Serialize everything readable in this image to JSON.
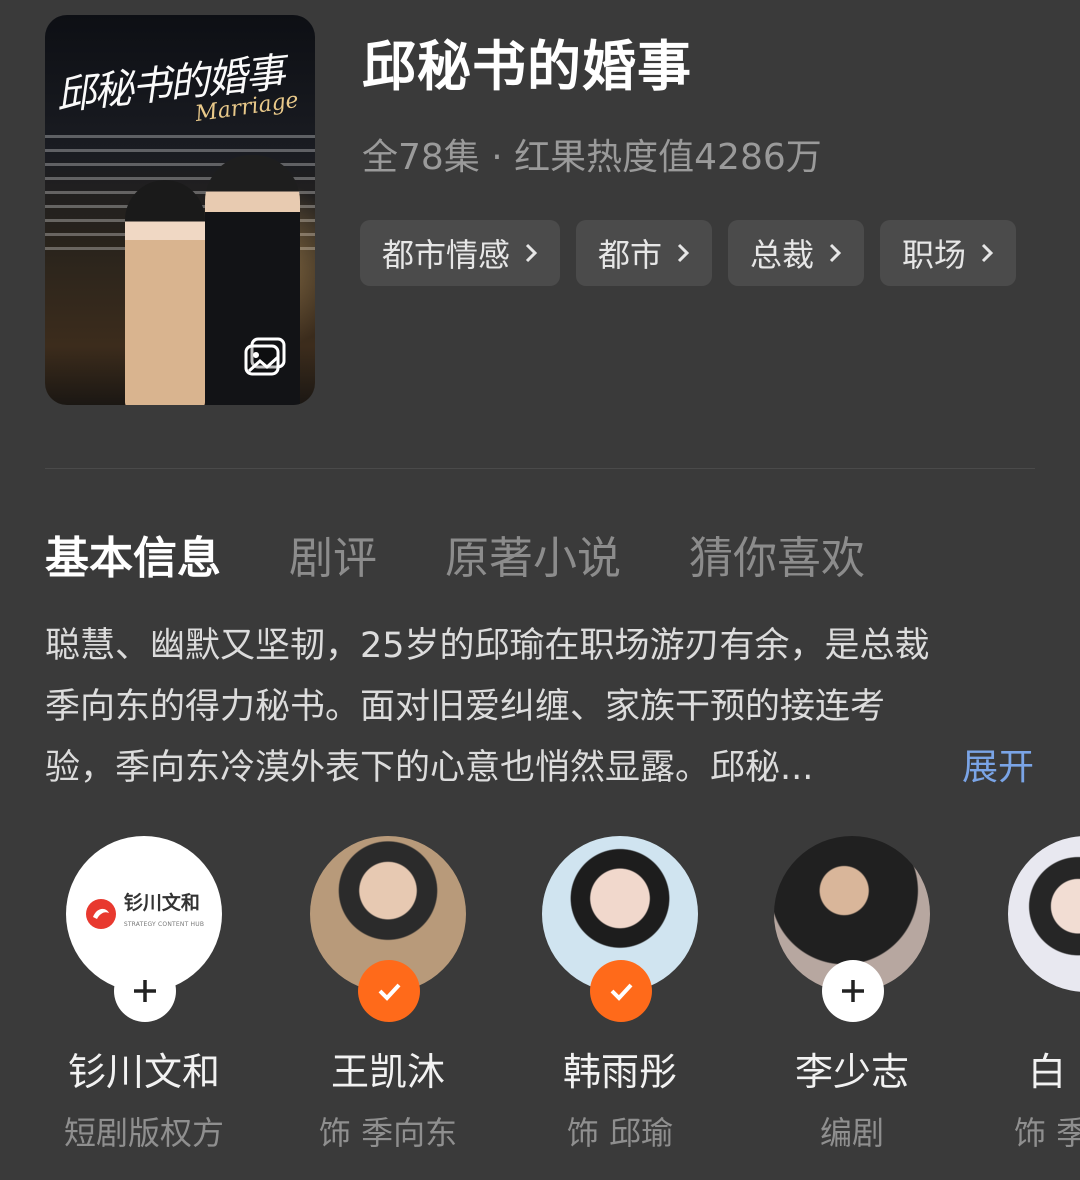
{
  "header": {
    "poster_title_calligraphy": "邱秘书的婚事",
    "poster_subtitle_script": "Marriage",
    "title": "邱秘书的婚事",
    "meta": "全78集 · 红果热度值4286万",
    "tags": [
      {
        "label": "都市情感"
      },
      {
        "label": "都市"
      },
      {
        "label": "总裁"
      },
      {
        "label": "职场"
      }
    ]
  },
  "tabs": [
    {
      "label": "基本信息",
      "active": true
    },
    {
      "label": "剧评",
      "active": false
    },
    {
      "label": "原著小说",
      "active": false
    },
    {
      "label": "猜你喜欢",
      "active": false
    }
  ],
  "description": {
    "lines": [
      "聪慧、幽默又坚韧，25岁的邱瑜在职场游刃有余，是总裁",
      "季向东的得力秘书。面对旧爱纠缠、家族干预的接连考",
      "验，季向东冷漠外表下的心意也悄然显露。邱秘..."
    ],
    "expand_label": "展开"
  },
  "cast": [
    {
      "name": "钐川文和",
      "role": "短剧版权方",
      "badge": "plus",
      "logo_text": "钐川文和",
      "logo_sub": "STRATEGY CONTENT HUB"
    },
    {
      "name": "王凯沐",
      "role": "饰 季向东",
      "badge": "check"
    },
    {
      "name": "韩雨彤",
      "role": "饰 邱瑜",
      "badge": "check"
    },
    {
      "name": "李少志",
      "role": "编剧",
      "badge": "plus"
    },
    {
      "name": "白",
      "role": "饰 季",
      "badge": "none"
    }
  ],
  "colors": {
    "background": "#3a3a3a",
    "accent_orange": "#ff6a1a",
    "link_blue": "#7aa4e6",
    "tag_bg": "#4b4b4b"
  },
  "icons": {
    "poster_overlay": "gallery-icon",
    "tag_arrow": "chevron-right-icon",
    "follow": "plus-icon",
    "followed": "check-icon"
  }
}
